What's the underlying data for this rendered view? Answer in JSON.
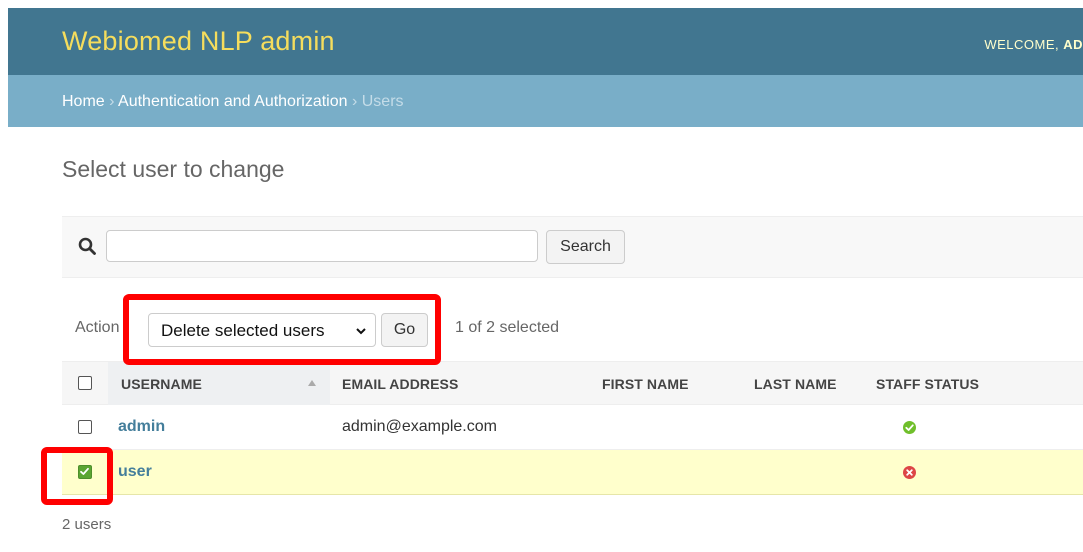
{
  "header": {
    "site_title": "Webiomed NLP admin",
    "welcome": "WELCOME, ",
    "username": "AD"
  },
  "breadcrumbs": {
    "home": "Home",
    "separator": " › ",
    "section": "Authentication and Authorization",
    "current": "Users"
  },
  "page_title": "Select user to change",
  "search": {
    "value": "",
    "placeholder": "",
    "button_label": "Search",
    "icon": "search-icon"
  },
  "actions": {
    "label": "Action",
    "selected_action": "Delete selected users",
    "go_label": "Go",
    "selected_count": "1 of 2 selected"
  },
  "table": {
    "columns": [
      "USERNAME",
      "EMAIL ADDRESS",
      "FIRST NAME",
      "LAST NAME",
      "STAFF STATUS"
    ],
    "sorted_column": "USERNAME",
    "rows": [
      {
        "username": "admin",
        "email": "admin@example.com",
        "first_name": "",
        "last_name": "",
        "staff_status": true,
        "selected": false
      },
      {
        "username": "user",
        "email": "",
        "first_name": "",
        "last_name": "",
        "staff_status": false,
        "selected": true
      }
    ]
  },
  "footer": {
    "count": "2 users"
  },
  "colors": {
    "header_bg": "#417690",
    "site_title": "#f5dd5d",
    "breadcrumb_bg": "#79aec8",
    "link": "#447e9b",
    "selected_row": "#ffffcc",
    "highlight": "#ff0000",
    "staff_yes": "#70bf2b",
    "staff_no": "#dd4646"
  }
}
